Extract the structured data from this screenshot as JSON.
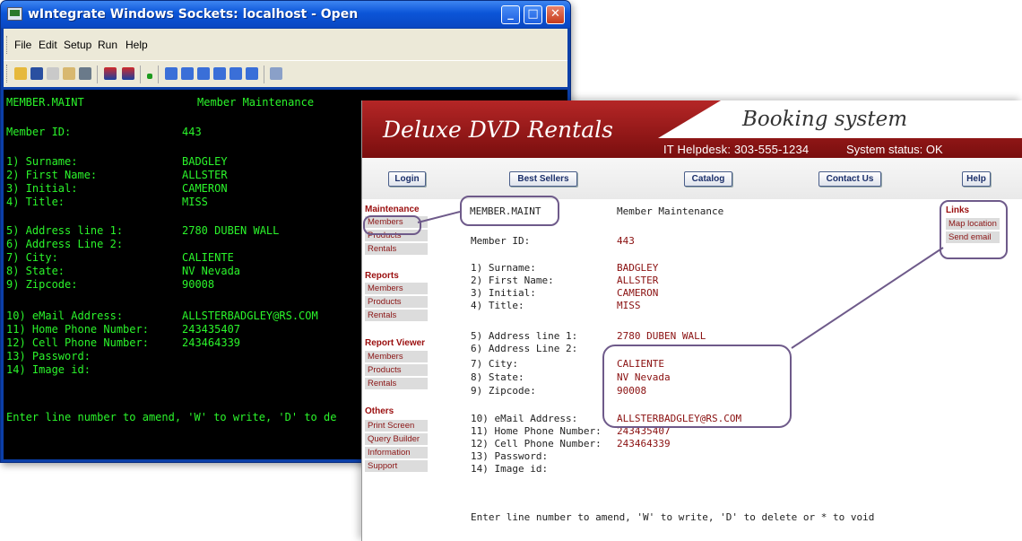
{
  "terminal": {
    "title": "wIntegrate Windows Sockets: localhost - Open",
    "menu": [
      "File",
      "Edit",
      "Setup",
      "Run",
      "Help"
    ],
    "controls": {
      "minimize": "_",
      "maximize": "□",
      "close": "✕"
    },
    "screen_title": "MEMBER.MAINT",
    "screen_heading": "Member Maintenance",
    "member_id_label": "Member ID:",
    "member_id": "443",
    "fields": [
      {
        "label": "1) Surname:",
        "value": "BADGLEY"
      },
      {
        "label": "2) First Name:",
        "value": "ALLSTER"
      },
      {
        "label": "3) Initial:",
        "value": "CAMERON"
      },
      {
        "label": "4) Title:",
        "value": "MISS"
      },
      {
        "label": "5) Address line 1:",
        "value": "2780 DUBEN WALL"
      },
      {
        "label": "6) Address Line 2:",
        "value": ""
      },
      {
        "label": "7) City:",
        "value": "CALIENTE"
      },
      {
        "label": "8) State:",
        "value": "NV Nevada"
      },
      {
        "label": "9) Zipcode:",
        "value": "90008"
      },
      {
        "label": "10) eMail Address:",
        "value": "ALLSTERBADGLEY@RS.COM"
      },
      {
        "label": "11) Home Phone Number:",
        "value": "243435407"
      },
      {
        "label": "12) Cell Phone Number:",
        "value": "243464339"
      },
      {
        "label": "13) Password:",
        "value": ""
      },
      {
        "label": "14) Image id:",
        "value": ""
      }
    ],
    "prompt": "Enter line number to amend, 'W' to write, 'D' to de",
    "colors": {
      "text": "#2bf42b",
      "background": "#000000",
      "titlebar": "#0b55d8"
    }
  },
  "web": {
    "brand": "Deluxe DVD Rentals",
    "tagline": "Booking system",
    "helpdesk": "IT Helpdesk: 303-555-1234",
    "status": "System status: OK",
    "nav": [
      "Login",
      "Best Sellers",
      "Catalog",
      "Contact Us",
      "Help"
    ],
    "sidebar": [
      {
        "heading": "Maintenance",
        "items": [
          "Members",
          "Products",
          "Rentals"
        ]
      },
      {
        "heading": "Reports",
        "items": [
          "Members",
          "Products",
          "Rentals"
        ]
      },
      {
        "heading": "Report Viewer",
        "items": [
          "Members",
          "Products",
          "Rentals"
        ]
      },
      {
        "heading": "Others",
        "items": [
          "Print Screen",
          "Query Builder",
          "Information",
          "Support"
        ]
      }
    ],
    "links_heading": "Links",
    "links": [
      "Map location",
      "Send email"
    ],
    "screen_title": "MEMBER.MAINT",
    "screen_heading": "Member Maintenance",
    "member_id_label": "Member ID:",
    "member_id": "443",
    "fields": [
      {
        "label": "1) Surname:",
        "value": "BADGLEY"
      },
      {
        "label": "2) First Name:",
        "value": "ALLSTER"
      },
      {
        "label": "3) Initial:",
        "value": "CAMERON"
      },
      {
        "label": "4) Title:",
        "value": "MISS"
      },
      {
        "label": "5) Address line 1:",
        "value": "2780 DUBEN WALL"
      },
      {
        "label": "6) Address Line 2:",
        "value": ""
      },
      {
        "label": "7) City:",
        "value": "CALIENTE"
      },
      {
        "label": "8) State:",
        "value": "NV Nevada"
      },
      {
        "label": "9) Zipcode:",
        "value": "90008"
      },
      {
        "label": "10) eMail Address:",
        "value": "ALLSTERBADGLEY@RS.COM"
      },
      {
        "label": "11) Home Phone Number:",
        "value": "243435407"
      },
      {
        "label": "12) Cell Phone Number:",
        "value": "243464339"
      },
      {
        "label": "13) Password:",
        "value": ""
      },
      {
        "label": "14) Image id:",
        "value": ""
      }
    ],
    "prompt": "Enter line number to amend, 'W' to write, 'D' to delete or * to void",
    "colors": {
      "banner": "#9a1414",
      "nav_text": "#1b2f6a",
      "highlight": "#6e5a8a"
    }
  }
}
